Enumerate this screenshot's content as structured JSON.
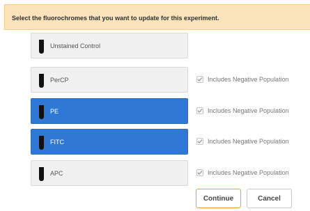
{
  "banner": {
    "text": "Select the fluorochromes that you want to update for this experiment."
  },
  "control": {
    "label": "Unstained Control",
    "icon": "test-tube-icon"
  },
  "fluorochromes": [
    {
      "label": "PerCP",
      "selected": false,
      "negative_label": "Includes Negative Population",
      "negative_checked": true
    },
    {
      "label": "PE",
      "selected": true,
      "negative_label": "Includes Negative Population",
      "negative_checked": true
    },
    {
      "label": "FITC",
      "selected": true,
      "negative_label": "Includes Negative Population",
      "negative_checked": true
    },
    {
      "label": "APC",
      "selected": false,
      "negative_label": "Includes Negative Population",
      "negative_checked": true
    }
  ],
  "buttons": {
    "continue_label": "Continue",
    "cancel_label": "Cancel"
  },
  "colors": {
    "banner": "#fae3ba",
    "selected": "#2f78d6",
    "continue_border": "#f0a030"
  }
}
